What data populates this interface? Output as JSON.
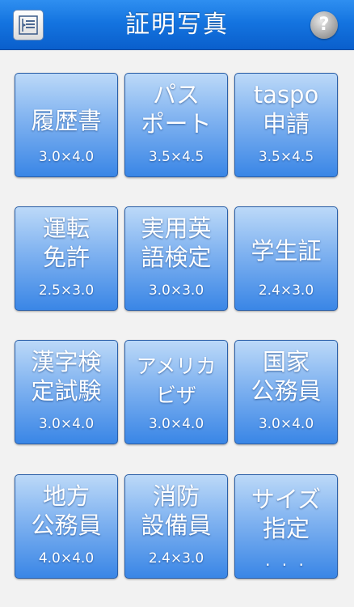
{
  "header": {
    "title": "証明写真",
    "help_label": "?",
    "menu_icon": "menu-list-icon"
  },
  "tiles": [
    {
      "label": "履歴書",
      "size": "3.0×4.0"
    },
    {
      "label": "パス\nポート",
      "size": "3.5×4.5"
    },
    {
      "label": "taspo\n申請",
      "size": "3.5×4.5"
    },
    {
      "label": "運転\n免許",
      "size": "2.5×3.0"
    },
    {
      "label": "実用英\n語検定",
      "size": "3.0×3.0"
    },
    {
      "label": "学生証",
      "size": "2.4×3.0"
    },
    {
      "label": "漢字検\n定試験",
      "size": "3.0×4.0"
    },
    {
      "label": "アメリカ\nビザ",
      "size": "3.0×4.0"
    },
    {
      "label": "国家\n公務員",
      "size": "3.0×4.0"
    },
    {
      "label": "地方\n公務員",
      "size": "4.0×4.0"
    },
    {
      "label": "消防\n設備員",
      "size": "2.4×3.0"
    },
    {
      "label": "サイズ\n指定",
      "size": ". . ."
    }
  ],
  "colors": {
    "header": "#1474e0",
    "tile_top": "#bcd9f8",
    "tile_bottom": "#3a86e6",
    "background": "#f2f2f2"
  }
}
